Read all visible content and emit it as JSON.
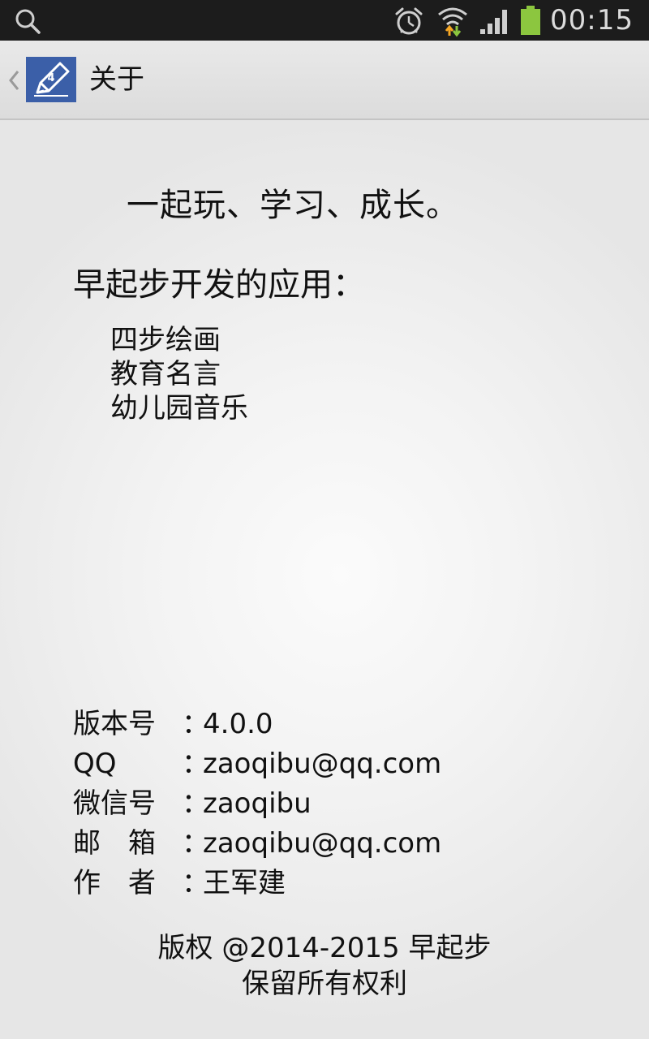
{
  "status_bar": {
    "time": "00:15",
    "icons": [
      "search-icon",
      "alarm-icon",
      "wifi-icon",
      "signal-icon",
      "battery-icon"
    ],
    "battery_color": "#8cc63f"
  },
  "action_bar": {
    "title": "关于",
    "logo_badge": "4",
    "logo_color": "#3b5fa8"
  },
  "about": {
    "slogan": "一起玩、学习、成长。",
    "apps_heading": "早起步开发的应用：",
    "apps": [
      "四步绘画",
      "教育名言",
      "幼儿园音乐"
    ]
  },
  "info": {
    "version_label": "版本号",
    "version": "4.0.0",
    "qq_label": "QQ",
    "qq": "zaoqibu@qq.com",
    "wechat_label": "微信号",
    "wechat": "zaoqibu",
    "email_label": "邮　箱",
    "email": "zaoqibu@qq.com",
    "author_label": "作　者",
    "author": "王军建",
    "separator": "："
  },
  "footer": {
    "copyright": "版权 @2014-2015 早起步",
    "rights": "保留所有权利"
  }
}
